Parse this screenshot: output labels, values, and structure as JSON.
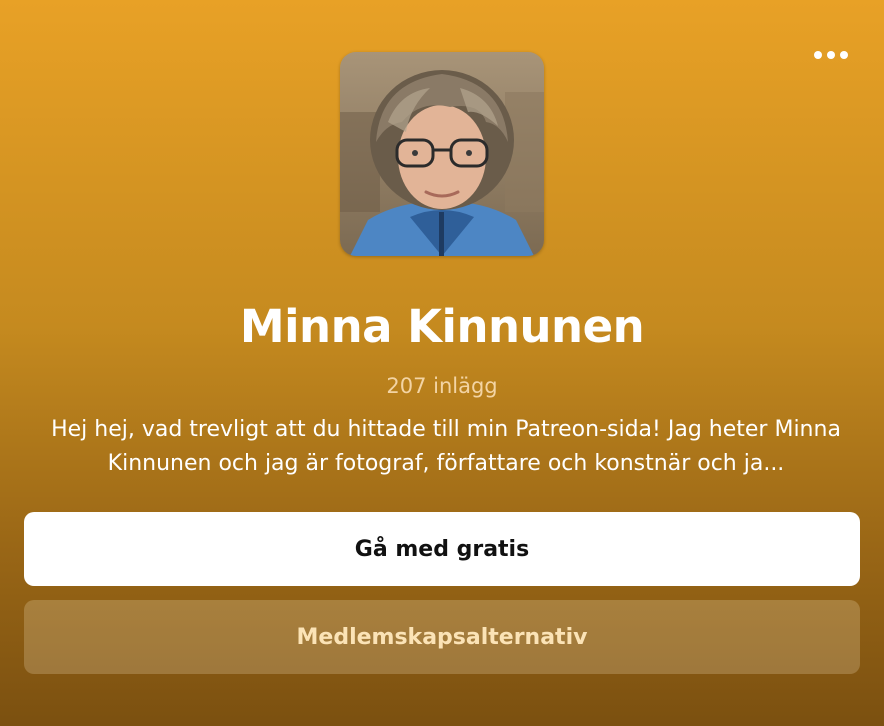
{
  "creator": {
    "name": "Minna Kinnunen",
    "posts_count": "207 inlägg",
    "bio": "Hej hej, vad trevligt att du hittade till min Patreon-sida! Jag heter Minna Kinnunen och jag är fotograf, författare och konstnär och ja..."
  },
  "actions": {
    "join_label": "Gå med gratis",
    "membership_label": "Medlemskapsalternativ"
  },
  "icons": {
    "more": "more-horizontal-icon"
  },
  "colors": {
    "background_top": "#e8a126",
    "background_bottom": "#7b5010",
    "join_button_bg": "#ffffff",
    "membership_text": "#fbe3b6"
  }
}
